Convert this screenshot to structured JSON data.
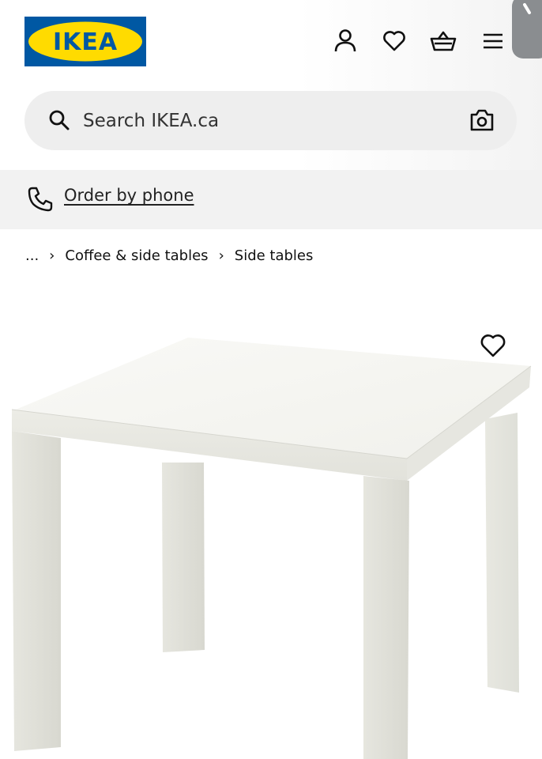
{
  "header": {
    "logo_text": "IKEA",
    "icons": [
      "user-icon",
      "heart-icon",
      "basket-icon",
      "menu-icon"
    ]
  },
  "search": {
    "placeholder": "Search IKEA.ca",
    "icon": "search-icon",
    "camera_icon": "camera-icon"
  },
  "order_phone": {
    "label": "Order by phone",
    "icon": "phone-icon"
  },
  "breadcrumb": {
    "ellipsis": "...",
    "separator": "›",
    "items": [
      "Coffee & side tables",
      "Side tables"
    ]
  },
  "product": {
    "favorite_icon": "heart-icon"
  },
  "colors": {
    "ikea_blue": "#0058a3",
    "ikea_yellow": "#ffdb00",
    "search_bg": "#eeeeee",
    "order_bg": "#f2f2f2"
  }
}
